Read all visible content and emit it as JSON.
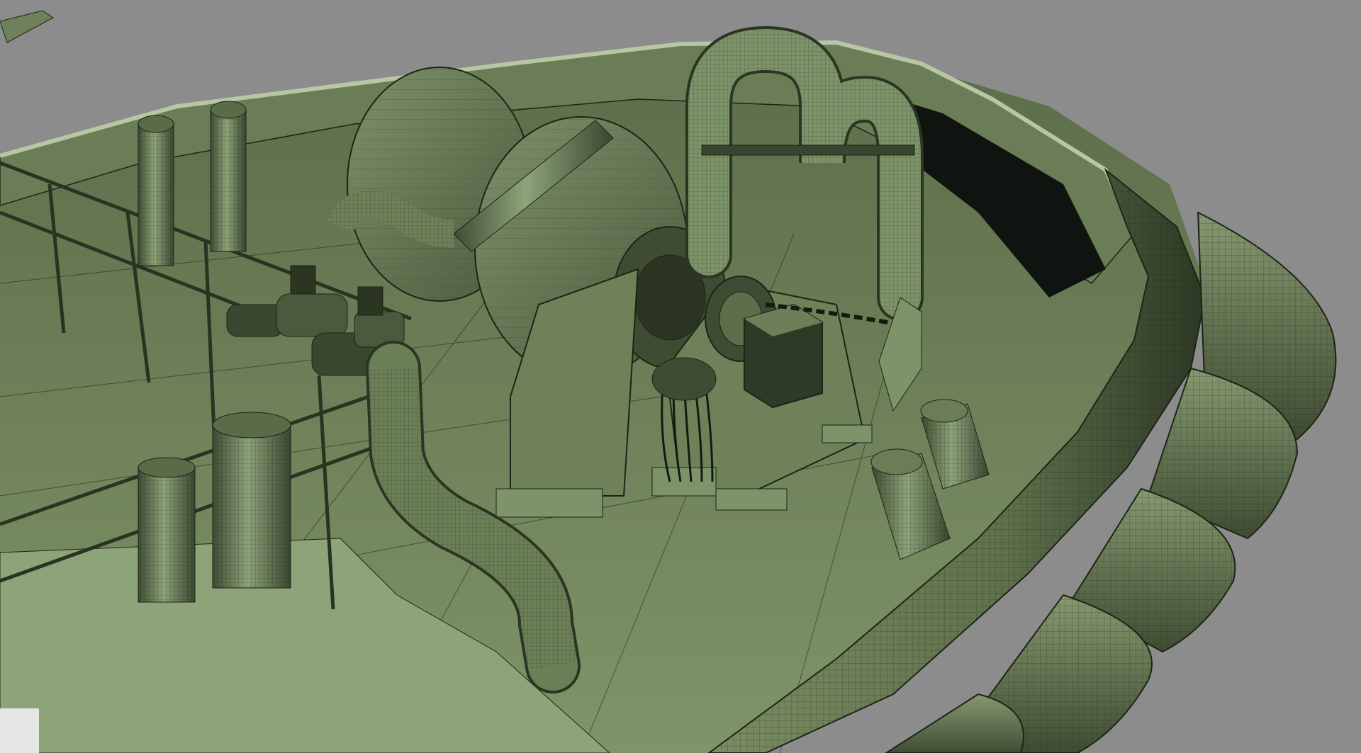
{
  "viewport": {
    "background_color": "#8c8c8c",
    "render_style": "smooth shaded with wireframe overlay",
    "subject_color": "#6e7f5a",
    "wire_color": "#1c2416"
  },
  "scene": {
    "components": [
      {
        "name": "deck",
        "icon": "deck-plane"
      },
      {
        "name": "bulwark",
        "icon": "curved-wall"
      },
      {
        "name": "fender-tubes",
        "icon": "cylinder-stack"
      },
      {
        "name": "winch-drum",
        "icon": "drum"
      },
      {
        "name": "bollard-pipes",
        "icon": "u-pipe"
      },
      {
        "name": "chain",
        "icon": "chain-links"
      },
      {
        "name": "railing",
        "icon": "handrail"
      },
      {
        "name": "vent-cylinders",
        "icon": "cylinder"
      },
      {
        "name": "hydraulic-motors",
        "icon": "motor"
      },
      {
        "name": "curved-pipe",
        "icon": "pipe-bend"
      }
    ]
  }
}
